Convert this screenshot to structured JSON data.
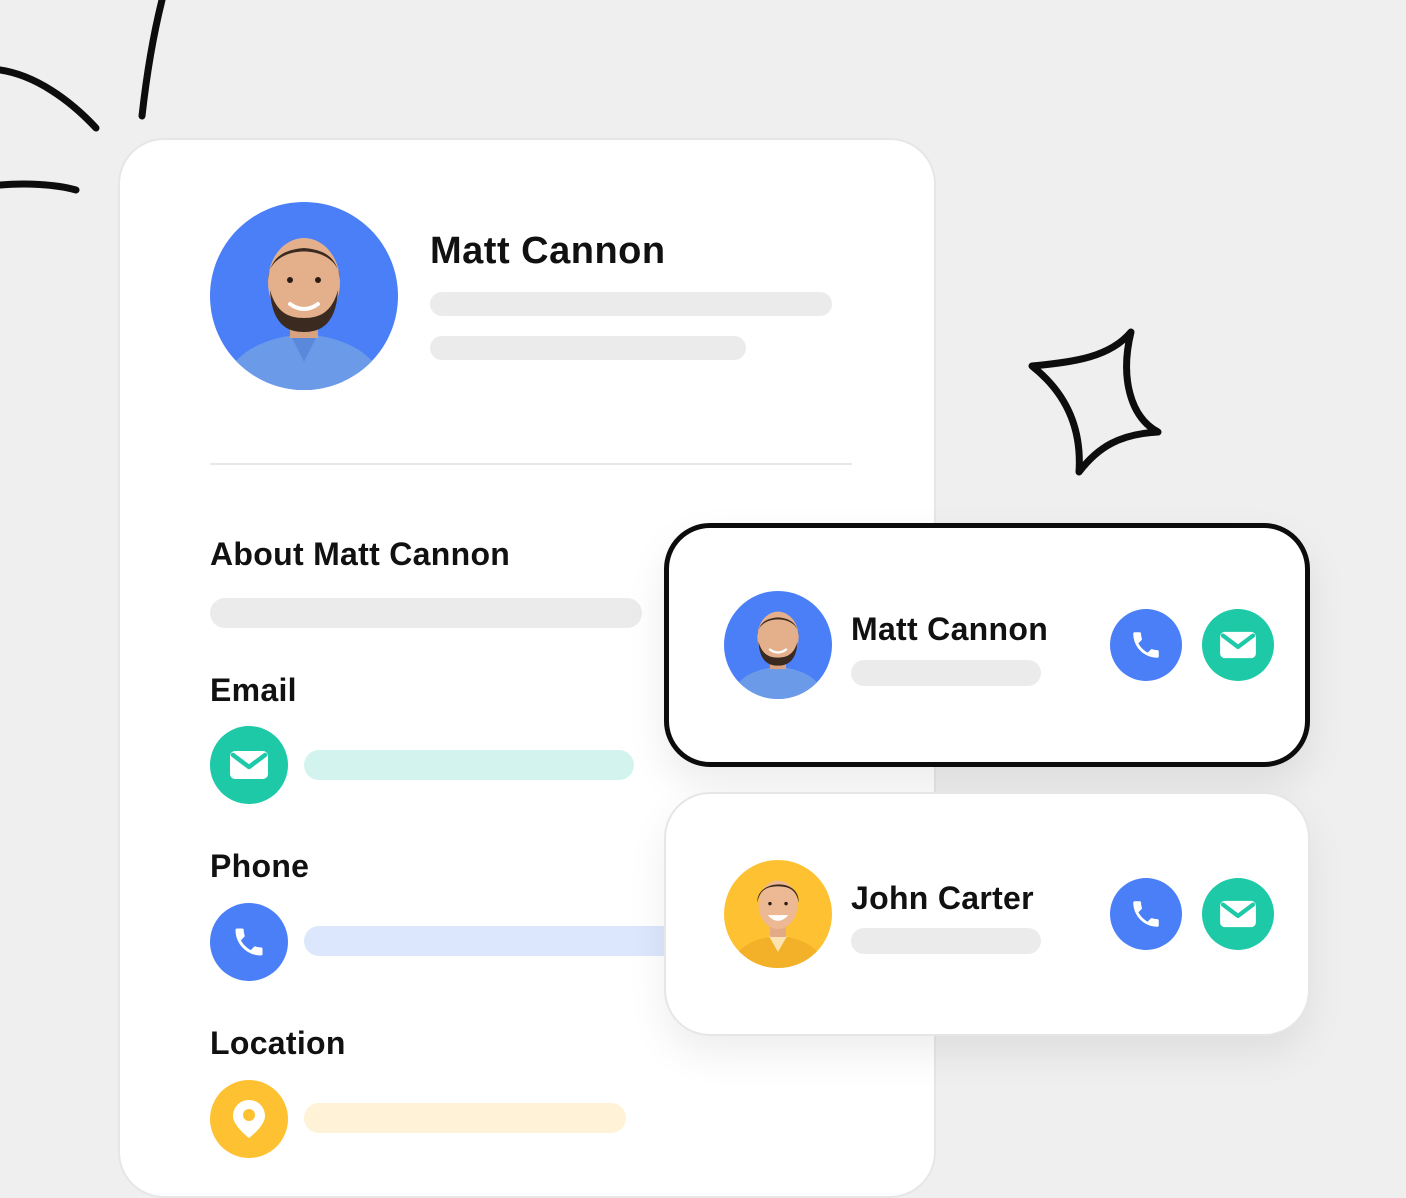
{
  "colors": {
    "background": "#efefef",
    "blue": "#4a7ff7",
    "teal": "#1dc9a7",
    "yellow": "#fec132",
    "skeleton": "#ebebeb",
    "email_bar": "#d3f4ee",
    "phone_bar": "#dce7fd",
    "location_bar": "#fff2d6"
  },
  "profile": {
    "name": "Matt Cannon",
    "about_label": "About Matt Cannon",
    "email_label": "Email",
    "phone_label": "Phone",
    "location_label": "Location",
    "email_icon": "mail-icon",
    "phone_icon": "phone-icon",
    "location_icon": "map-pin-icon"
  },
  "contacts": [
    {
      "name": "Matt Cannon",
      "avatar_color": "#4a7ff7",
      "call_icon": "phone-icon",
      "mail_icon": "mail-icon"
    },
    {
      "name": "John Carter",
      "avatar_color": "#fec132",
      "call_icon": "phone-icon",
      "mail_icon": "mail-icon"
    }
  ]
}
